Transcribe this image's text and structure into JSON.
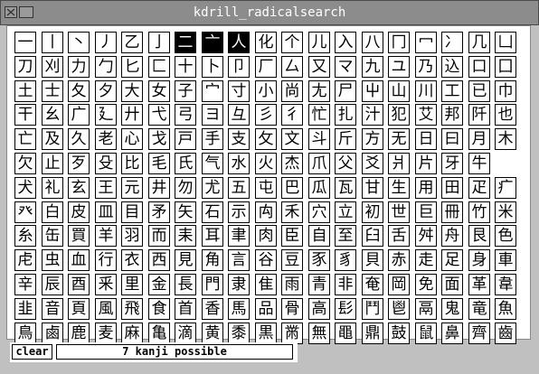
{
  "window": {
    "title": "kdrill_radicalsearch"
  },
  "grid": {
    "rows": [
      [
        "一",
        "丨",
        "丶",
        "丿",
        "乙",
        "亅",
        "二",
        "亠",
        "人",
        "化",
        "个",
        "儿",
        "入",
        "八",
        "冂",
        "冖",
        "冫",
        "几",
        "凵"
      ],
      [
        "刀",
        "刈",
        "力",
        "勹",
        "匕",
        "匚",
        "十",
        "卜",
        "卩",
        "厂",
        "厶",
        "又",
        "マ",
        "九",
        "ユ",
        "乃",
        "込",
        "口",
        "囗"
      ],
      [
        "土",
        "士",
        "夂",
        "夕",
        "大",
        "女",
        "子",
        "宀",
        "寸",
        "小",
        "尚",
        "尢",
        "尸",
        "屮",
        "山",
        "川",
        "工",
        "已",
        "巾"
      ],
      [
        "干",
        "幺",
        "广",
        "廴",
        "廾",
        "弋",
        "弓",
        "ヨ",
        "彑",
        "彡",
        "彳",
        "忙",
        "扎",
        "汁",
        "犯",
        "艾",
        "邦",
        "阡",
        "也"
      ],
      [
        "亡",
        "及",
        "久",
        "老",
        "心",
        "戈",
        "戸",
        "手",
        "支",
        "攵",
        "文",
        "斗",
        "斤",
        "方",
        "无",
        "日",
        "曰",
        "月",
        "木"
      ],
      [
        "欠",
        "止",
        "歹",
        "殳",
        "比",
        "毛",
        "氏",
        "气",
        "水",
        "火",
        "杰",
        "爪",
        "父",
        "爻",
        "爿",
        "片",
        "牙",
        "牛"
      ],
      [
        "犬",
        "礼",
        "玄",
        "王",
        "元",
        "井",
        "勿",
        "尤",
        "五",
        "屯",
        "巴",
        "瓜",
        "瓦",
        "甘",
        "生",
        "用",
        "田",
        "疋",
        "疒"
      ],
      [
        "癶",
        "白",
        "皮",
        "皿",
        "目",
        "矛",
        "矢",
        "石",
        "示",
        "禸",
        "禾",
        "穴",
        "立",
        "初",
        "世",
        "巨",
        "冊",
        "竹",
        "米"
      ],
      [
        "糸",
        "缶",
        "買",
        "羊",
        "羽",
        "而",
        "耒",
        "耳",
        "聿",
        "肉",
        "臣",
        "自",
        "至",
        "臼",
        "舌",
        "舛",
        "舟",
        "艮",
        "色"
      ],
      [
        "虍",
        "虫",
        "血",
        "行",
        "衣",
        "西",
        "見",
        "角",
        "言",
        "谷",
        "豆",
        "豕",
        "豸",
        "貝",
        "赤",
        "走",
        "足",
        "身",
        "車"
      ],
      [
        "辛",
        "辰",
        "酉",
        "釆",
        "里",
        "金",
        "長",
        "門",
        "隶",
        "隹",
        "雨",
        "青",
        "非",
        "奄",
        "岡",
        "免",
        "面",
        "革",
        "韋"
      ],
      [
        "韭",
        "音",
        "頁",
        "風",
        "飛",
        "食",
        "首",
        "香",
        "馬",
        "品",
        "骨",
        "高",
        "髟",
        "鬥",
        "鬯",
        "鬲",
        "鬼",
        "竜",
        "魚"
      ],
      [
        "鳥",
        "鹵",
        "鹿",
        "麦",
        "麻",
        "亀",
        "滴",
        "黄",
        "黍",
        "黒",
        "黹",
        "無",
        "黽",
        "鼎",
        "鼓",
        "鼠",
        "鼻",
        "齊",
        "齒"
      ]
    ],
    "selected": [
      "二",
      "亠",
      "人"
    ]
  },
  "controls": {
    "clear_label": "clear",
    "status": "7 kanji possible"
  },
  "colors": {
    "selected_bg": "#000000",
    "cell_bg": "#ffffff",
    "window_bg": "#c0c0c0",
    "titlebar_bg": "#8c8c8c"
  }
}
